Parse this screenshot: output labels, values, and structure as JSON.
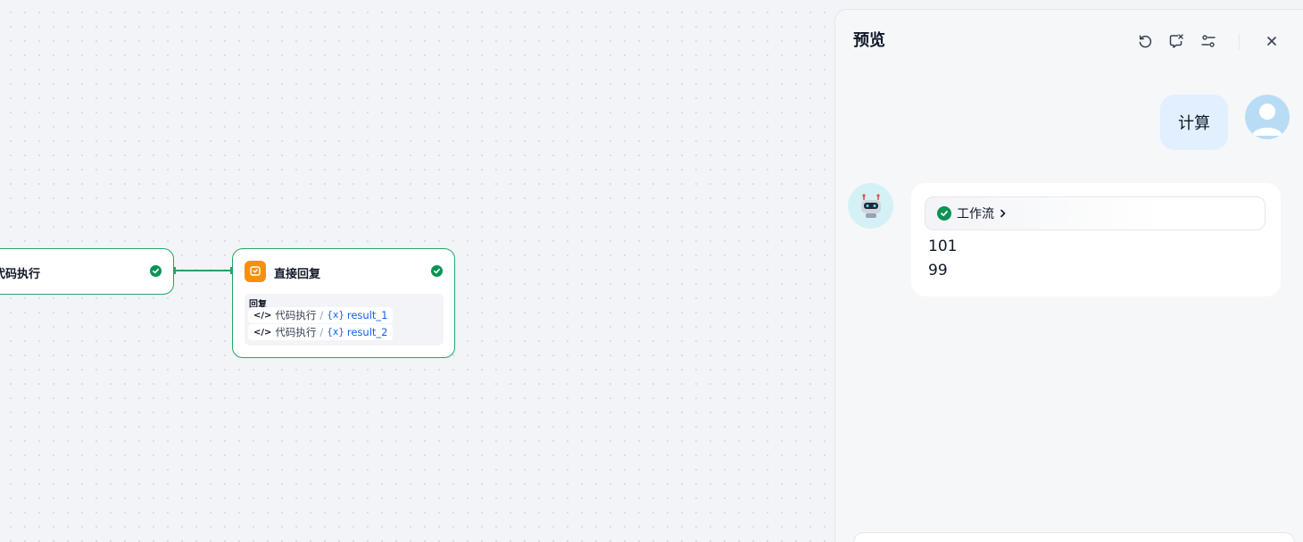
{
  "canvas": {
    "code_node": {
      "title": "代码执行"
    },
    "reply_node": {
      "title": "直接回复",
      "reply_label": "回复",
      "variables": [
        {
          "source": "代码执行",
          "name": "result_1"
        },
        {
          "source": "代码执行",
          "name": "result_2"
        }
      ]
    }
  },
  "preview": {
    "title": "预览",
    "user_message": "计算",
    "bot_message": {
      "workflow_label": "工作流",
      "lines": [
        "101",
        "99"
      ]
    }
  },
  "colors": {
    "success": "#079455",
    "edge": "#22a764",
    "reply_node_icon": "#f79009",
    "variable": "#155eef"
  }
}
